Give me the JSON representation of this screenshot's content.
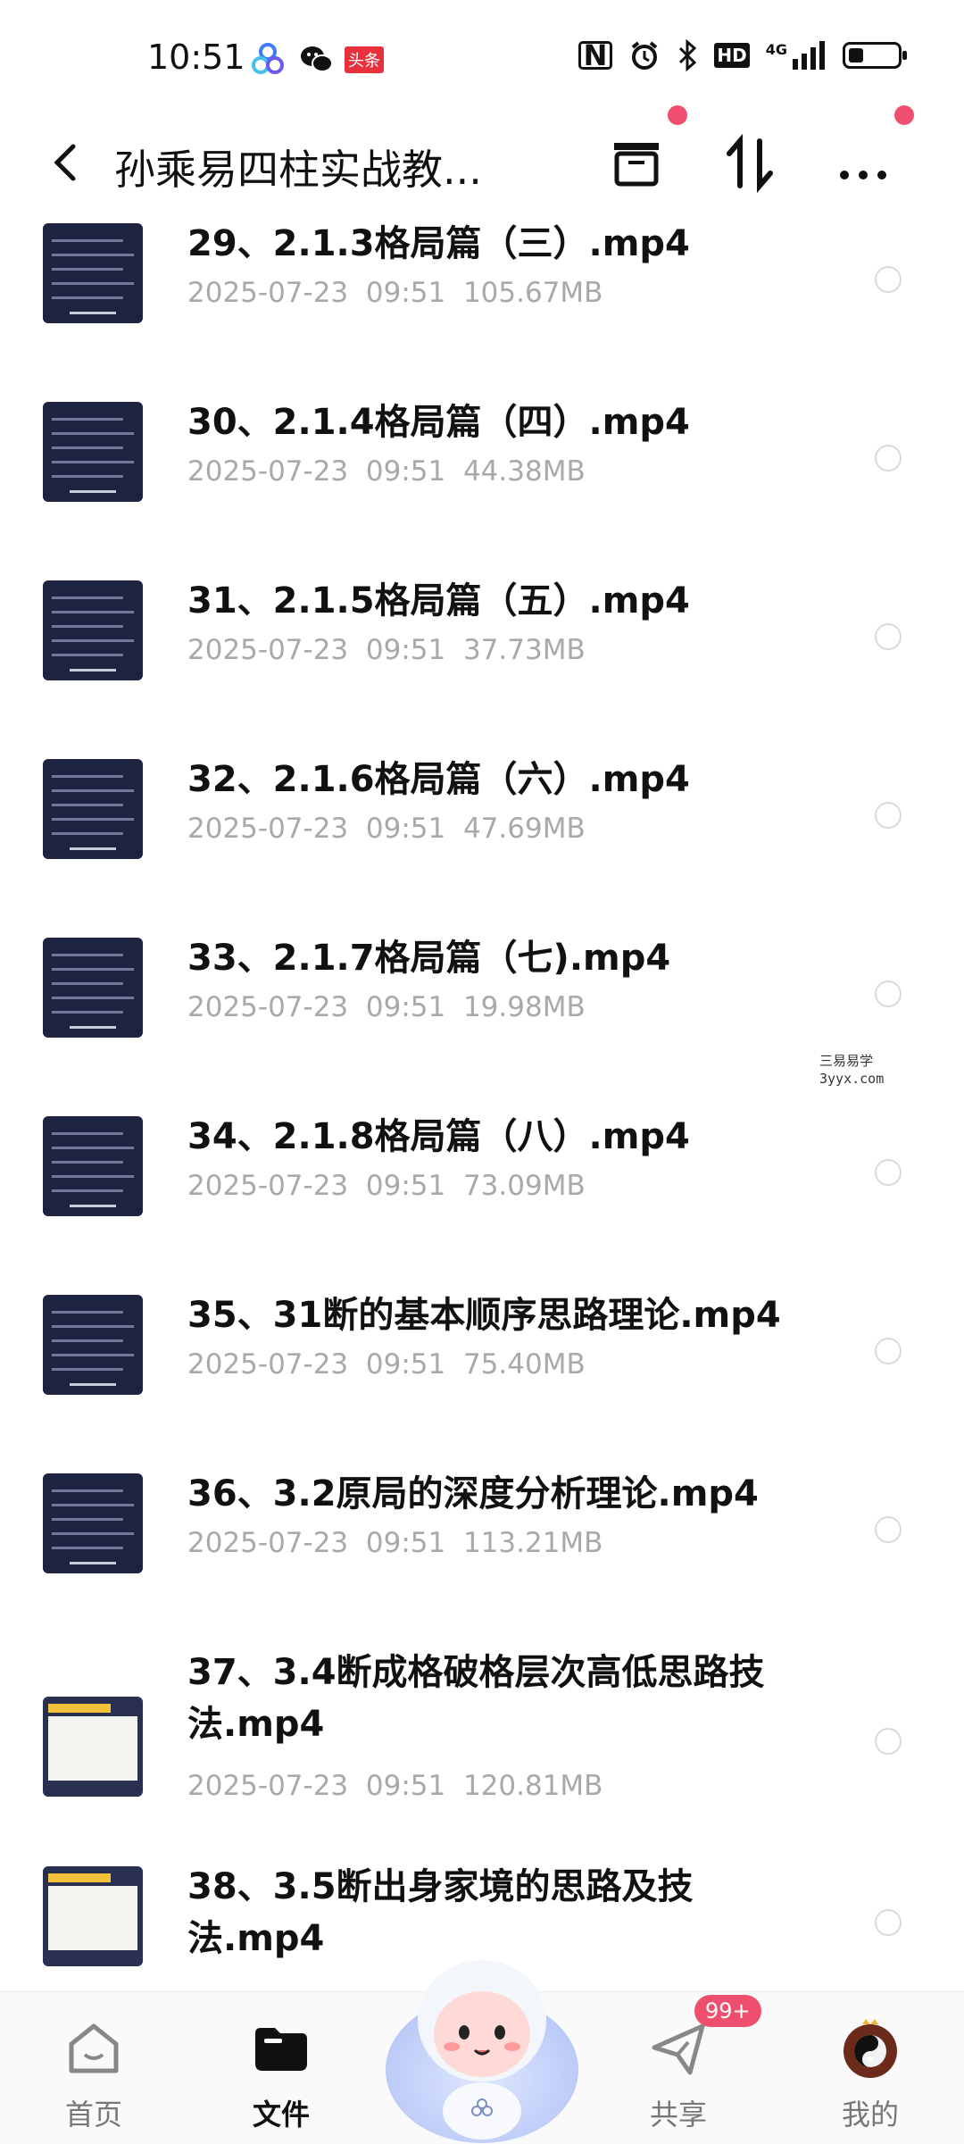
{
  "status_bar": {
    "time": "10:51",
    "app_badge": "头条",
    "network": "4G",
    "hd": "HD",
    "battery_level": 0.3
  },
  "header": {
    "title": "孙乘易四柱实战教...",
    "back_icon": "back-arrow-icon",
    "actions": [
      "archive-icon",
      "sort-icon",
      "more-icon"
    ]
  },
  "files": [
    {
      "name": "29、2.1.3格局篇（三）.mp4",
      "date": "2025-07-23",
      "time": "09:51",
      "size": "105.67MB",
      "thumb": "dark"
    },
    {
      "name": "30、2.1.4格局篇（四）.mp4",
      "date": "2025-07-23",
      "time": "09:51",
      "size": "44.38MB",
      "thumb": "dark"
    },
    {
      "name": "31、2.1.5格局篇（五）.mp4",
      "date": "2025-07-23",
      "time": "09:51",
      "size": "37.73MB",
      "thumb": "dark"
    },
    {
      "name": "32、2.1.6格局篇（六）.mp4",
      "date": "2025-07-23",
      "time": "09:51",
      "size": "47.69MB",
      "thumb": "dark"
    },
    {
      "name": "33、2.1.7格局篇（七).mp4",
      "date": "2025-07-23",
      "time": "09:51",
      "size": "19.98MB",
      "thumb": "dark"
    },
    {
      "name": "34、2.1.8格局篇（八）.mp4",
      "date": "2025-07-23",
      "time": "09:51",
      "size": "73.09MB",
      "thumb": "dark"
    },
    {
      "name": "35、31断的基本顺序思路理论.mp4",
      "date": "2025-07-23",
      "time": "09:51",
      "size": "75.40MB",
      "thumb": "dark"
    },
    {
      "name": "36、3.2原局的深度分析理论.mp4",
      "date": "2025-07-23",
      "time": "09:51",
      "size": "113.21MB",
      "thumb": "dark"
    },
    {
      "name": "37、3.4断成格破格层次高低思路技法.mp4",
      "date": "2025-07-23",
      "time": "09:51",
      "size": "120.81MB",
      "thumb": "light"
    },
    {
      "name": "38、3.5断出身家境的思路及技法.mp4",
      "date": "",
      "time": "",
      "size": "",
      "thumb": "light"
    }
  ],
  "watermark": [
    "三易易学",
    "3yyx.com"
  ],
  "bottom_nav": {
    "items": [
      {
        "label": "首页",
        "icon": "home-icon",
        "active": false
      },
      {
        "label": "文件",
        "icon": "folder-icon",
        "active": true
      },
      {
        "label": "共享",
        "icon": "send-icon",
        "active": false
      },
      {
        "label": "我的",
        "icon": "avatar-icon",
        "active": false
      }
    ],
    "share_badge": "99+"
  },
  "colors": {
    "accent_red": "#f04e6e",
    "meta_gray": "#a9a9a9",
    "thumb_bg": "#1e2440"
  }
}
